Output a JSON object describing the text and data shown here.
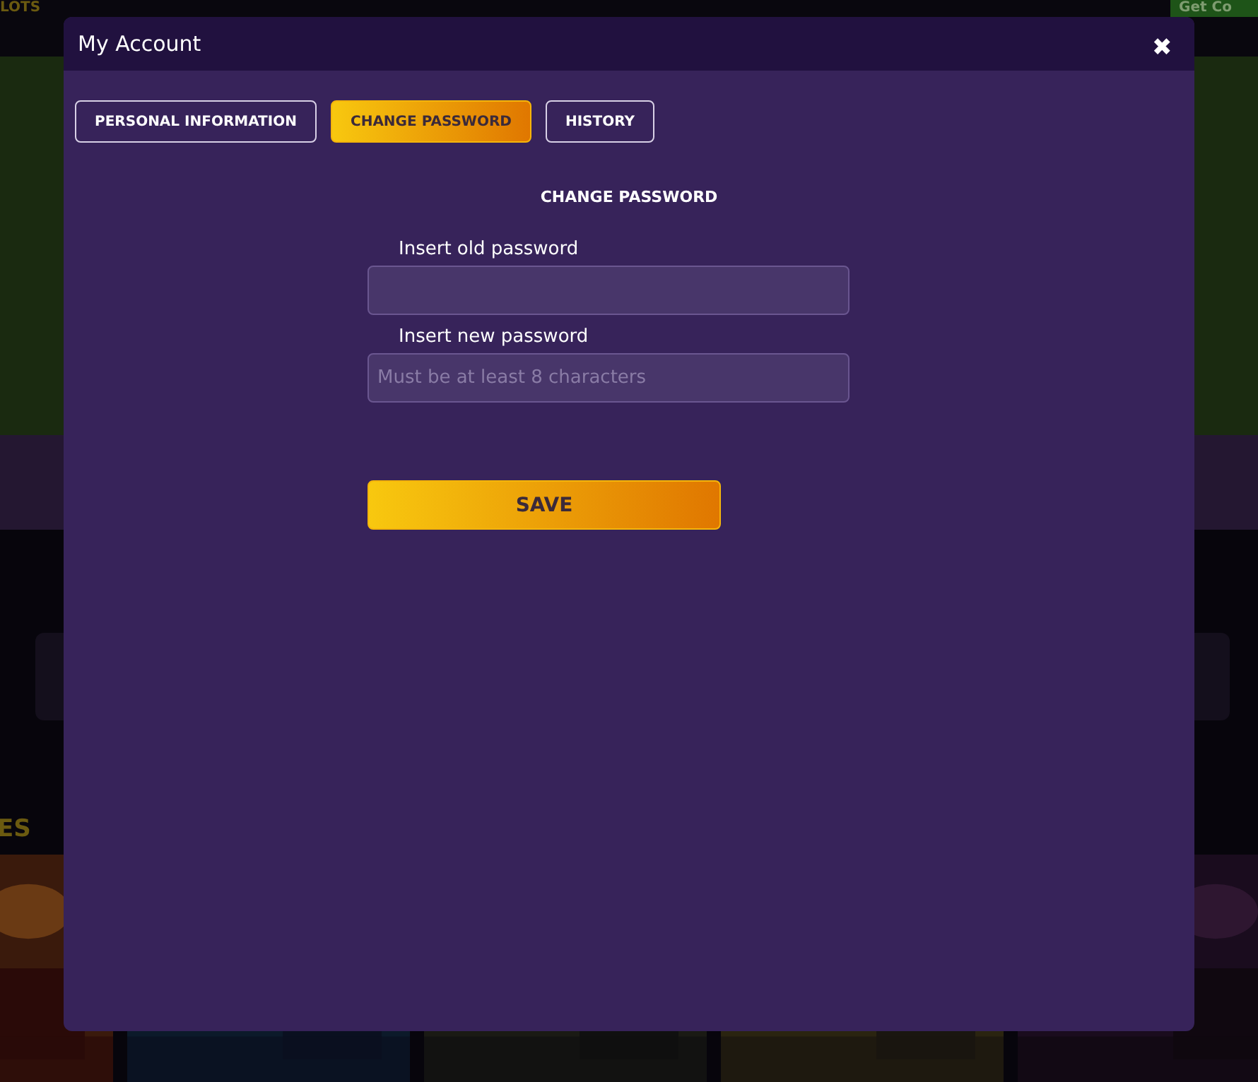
{
  "background": {
    "logo_text": "LOTS",
    "coins_button": "Get Co",
    "section_heading": "ES"
  },
  "modal": {
    "title": "My Account",
    "close": "✖",
    "tabs": [
      {
        "label": "PERSONAL INFORMATION",
        "selected": false
      },
      {
        "label": "CHANGE PASSWORD",
        "selected": true
      },
      {
        "label": "HISTORY",
        "selected": false
      }
    ],
    "heading": "CHANGE PASSWORD",
    "fields": [
      {
        "label": "Insert old password"
      },
      {
        "label": "Insert new password",
        "placeholder": "Must be at least 8 characters"
      }
    ],
    "save_button": "SAVE"
  }
}
